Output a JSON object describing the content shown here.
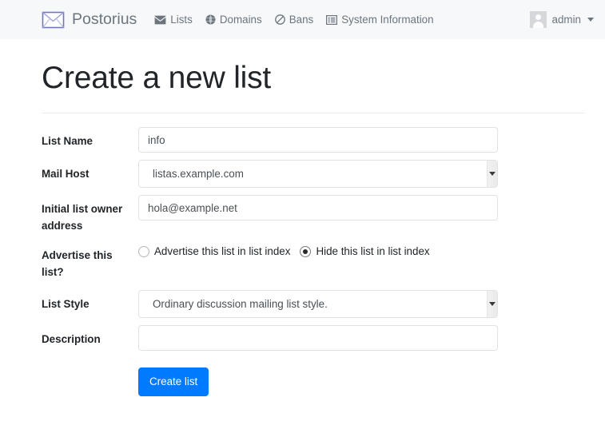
{
  "navbar": {
    "brand": {
      "label": "Postorius",
      "icon": "envelope-logo-icon"
    },
    "items": [
      {
        "label": "Lists",
        "icon": "envelope-icon"
      },
      {
        "label": "Domains",
        "icon": "globe-icon"
      },
      {
        "label": "Bans",
        "icon": "ban-icon"
      },
      {
        "label": "System Information",
        "icon": "list-alt-icon"
      }
    ],
    "user": {
      "label": "admin",
      "avatar_icon": "user-avatar-icon",
      "caret_icon": "caret-down-icon"
    }
  },
  "page": {
    "title": "Create a new list"
  },
  "form": {
    "list_name": {
      "label": "List Name",
      "value": "info",
      "placeholder": ""
    },
    "mail_host": {
      "label": "Mail Host",
      "value": "listas.example.com",
      "options": [
        "listas.example.com"
      ]
    },
    "owner_address": {
      "label": "Initial list owner address",
      "value": "hola@example.net",
      "placeholder": ""
    },
    "advertise": {
      "label": "Advertise this list?",
      "options": [
        {
          "label": "Advertise this list in list index",
          "checked": false
        },
        {
          "label": "Hide this list in list index",
          "checked": true
        }
      ]
    },
    "list_style": {
      "label": "List Style",
      "value": "Ordinary discussion mailing list style.",
      "options": [
        "Ordinary discussion mailing list style."
      ]
    },
    "description": {
      "label": "Description",
      "value": "",
      "placeholder": ""
    },
    "submit": {
      "label": "Create list"
    }
  },
  "colors": {
    "navbar_bg": "#f6f8fa",
    "brand_text": "#6c757d",
    "primary": "#007bff",
    "logo_stroke": "#6f72b5",
    "border": "#dfe3e8"
  }
}
